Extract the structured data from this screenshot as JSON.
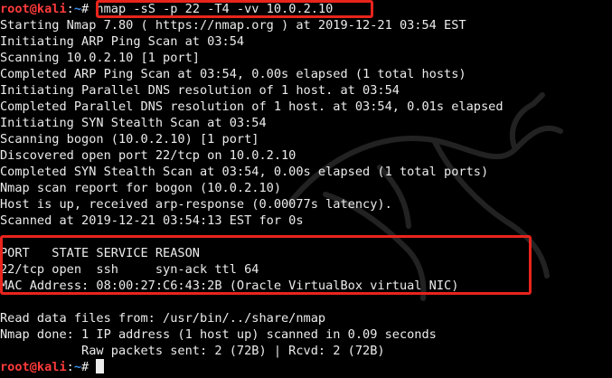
{
  "prompt": {
    "user": "root@kali",
    "separator": ":",
    "path": "~",
    "symbol": "#"
  },
  "command": "nmap -sS -p 22 -T4 -vv 10.0.2.10",
  "output": [
    "Starting Nmap 7.80 ( https://nmap.org ) at 2019-12-21 03:54 EST",
    "Initiating ARP Ping Scan at 03:54",
    "Scanning 10.0.2.10 [1 port]",
    "Completed ARP Ping Scan at 03:54, 0.00s elapsed (1 total hosts)",
    "Initiating Parallel DNS resolution of 1 host. at 03:54",
    "Completed Parallel DNS resolution of 1 host. at 03:54, 0.01s elapsed",
    "Initiating SYN Stealth Scan at 03:54",
    "Scanning bogon (10.0.2.10) [1 port]",
    "Discovered open port 22/tcp on 10.0.2.10",
    "Completed SYN Stealth Scan at 03:54, 0.00s elapsed (1 total ports)",
    "Nmap scan report for bogon (10.0.2.10)",
    "Host is up, received arp-response (0.00077s latency).",
    "Scanned at 2019-12-21 03:54:13 EST for 0s",
    "",
    "PORT   STATE SERVICE REASON",
    "22/tcp open  ssh     syn-ack ttl 64",
    "MAC Address: 08:00:27:C6:43:2B (Oracle VirtualBox virtual NIC)",
    "",
    "Read data files from: /usr/bin/../share/nmap",
    "Nmap done: 1 IP address (1 host up) scanned in 0.09 seconds",
    "           Raw packets sent: 2 (72B) | Rcvd: 2 (72B)"
  ],
  "colors": {
    "background": "#000000",
    "text": "#ececec",
    "prompt_user": "#ff3b3b",
    "prompt_path": "#3b8eea",
    "highlight": "#e8241c"
  },
  "icons": {
    "background_logo": "kali-dragon-icon"
  }
}
